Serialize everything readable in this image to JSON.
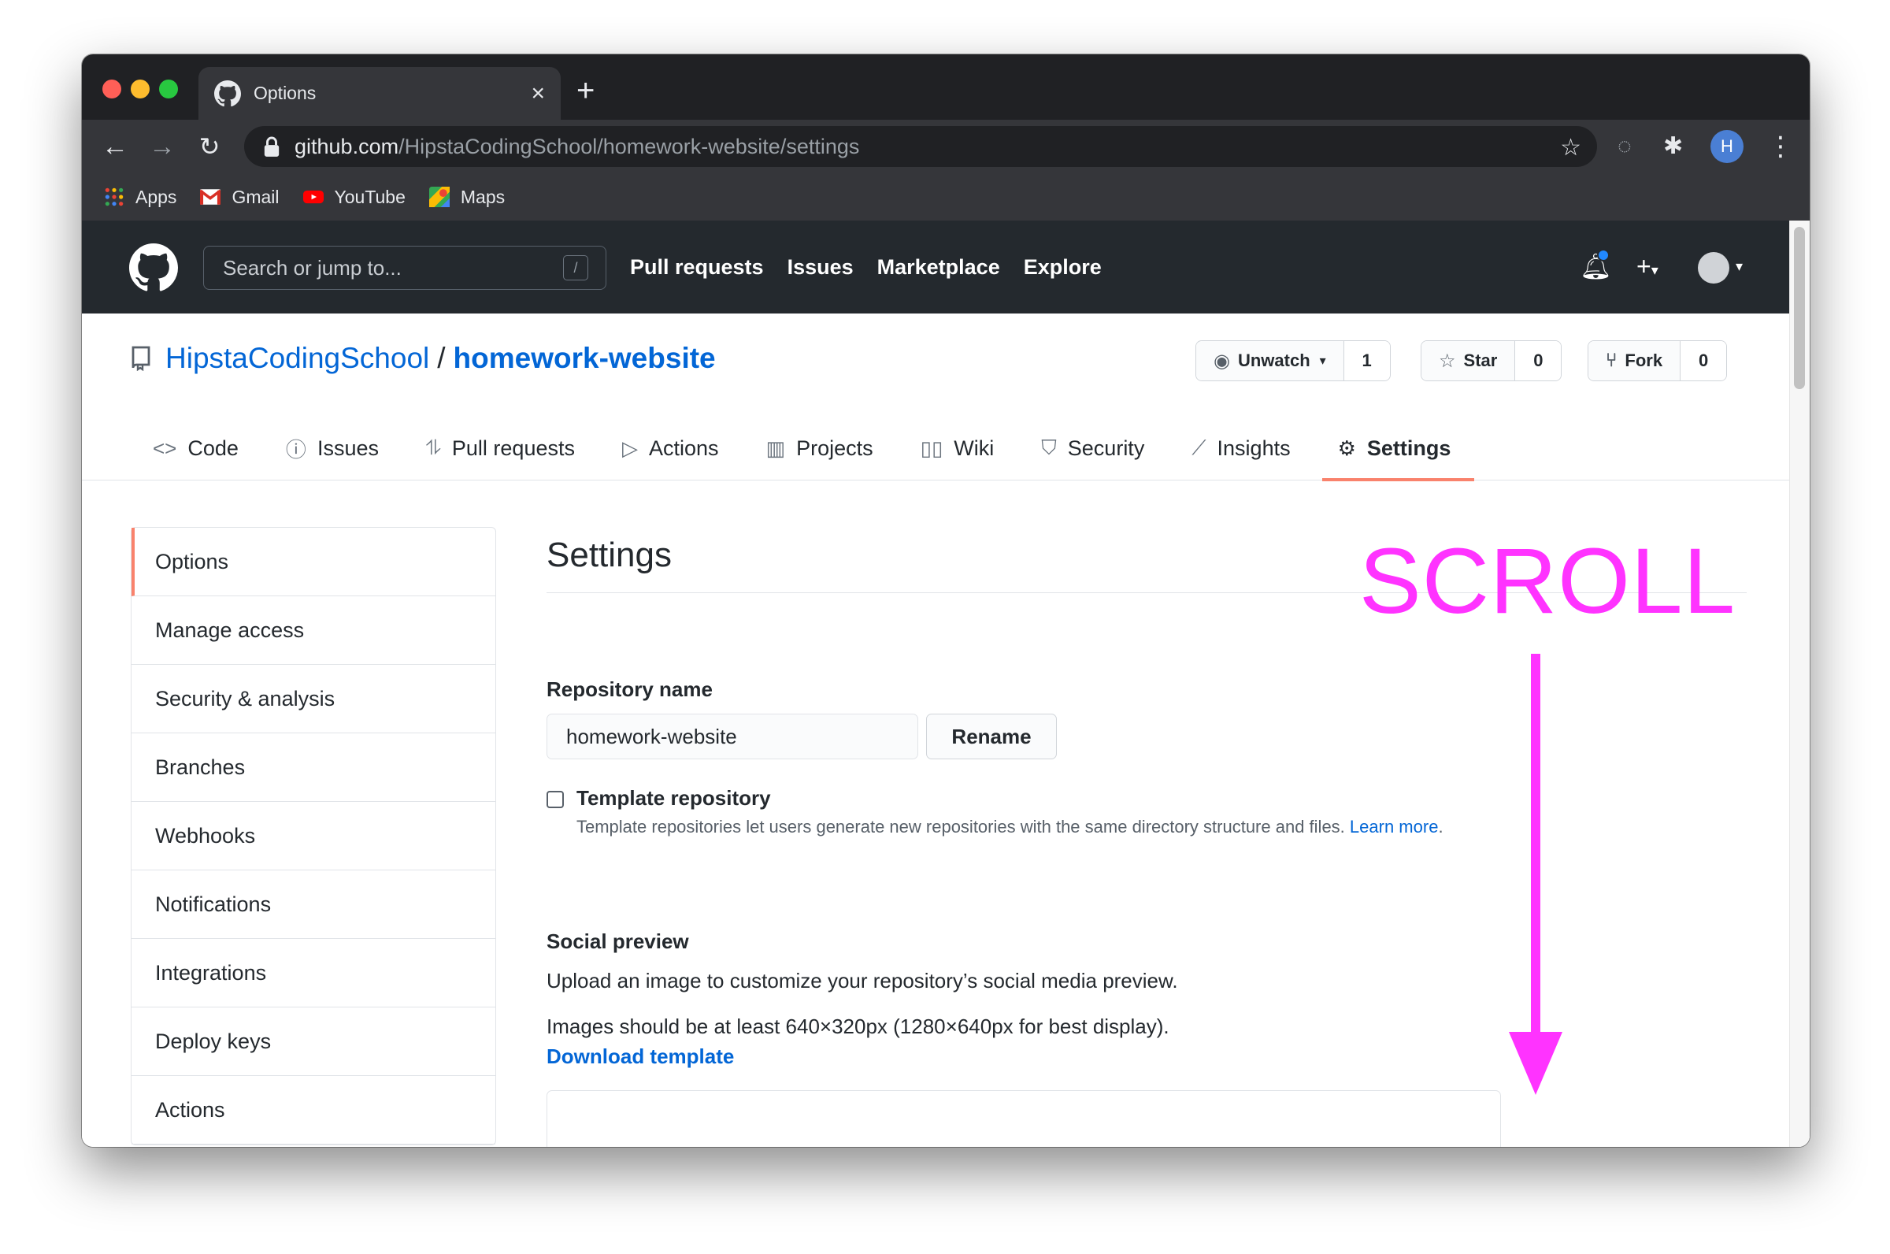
{
  "browser": {
    "tab_title": "Options",
    "close_glyph": "×",
    "new_tab_glyph": "+",
    "url_host": "github.com",
    "url_path": "/HipstaCodingSchool/homework-website/settings",
    "profile_letter": "H",
    "bookmarks": [
      {
        "label": "Apps",
        "icon": "apps-grid-icon"
      },
      {
        "label": "Gmail",
        "icon": "gmail-icon"
      },
      {
        "label": "YouTube",
        "icon": "youtube-icon"
      },
      {
        "label": "Maps",
        "icon": "maps-icon"
      }
    ]
  },
  "github": {
    "search_placeholder": "Search or jump to...",
    "search_key": "/",
    "nav": [
      "Pull requests",
      "Issues",
      "Marketplace",
      "Explore"
    ]
  },
  "repo": {
    "owner": "HipstaCodingSchool",
    "separator": "/",
    "name": "homework-website",
    "watch": {
      "label": "Unwatch",
      "count": "1"
    },
    "star": {
      "label": "Star",
      "count": "0"
    },
    "fork": {
      "label": "Fork",
      "count": "0"
    },
    "tabs": [
      {
        "label": "Code",
        "icon": "code-icon"
      },
      {
        "label": "Issues",
        "icon": "issue-opened-icon"
      },
      {
        "label": "Pull requests",
        "icon": "pull-request-icon"
      },
      {
        "label": "Actions",
        "icon": "play-icon"
      },
      {
        "label": "Projects",
        "icon": "project-icon"
      },
      {
        "label": "Wiki",
        "icon": "book-icon"
      },
      {
        "label": "Security",
        "icon": "shield-icon"
      },
      {
        "label": "Insights",
        "icon": "graph-icon"
      },
      {
        "label": "Settings",
        "icon": "gear-icon",
        "active": true
      }
    ]
  },
  "sidebar": {
    "items": [
      {
        "label": "Options",
        "active": true
      },
      {
        "label": "Manage access"
      },
      {
        "label": "Security & analysis"
      },
      {
        "label": "Branches"
      },
      {
        "label": "Webhooks"
      },
      {
        "label": "Notifications"
      },
      {
        "label": "Integrations"
      },
      {
        "label": "Deploy keys"
      },
      {
        "label": "Actions"
      }
    ]
  },
  "settings": {
    "title": "Settings",
    "repo_name_label": "Repository name",
    "repo_name_value": "homework-website",
    "rename_label": "Rename",
    "template_label": "Template repository",
    "template_note": "Template repositories let users generate new repositories with the same directory structure and files.",
    "learn_more": "Learn more",
    "template_checked": false,
    "social_preview_label": "Social preview",
    "social_preview_desc": "Upload an image to customize your repository’s social media preview.",
    "image_size_note": "Images should be at least 640×320px (1280×640px for best display).",
    "download_template": "Download template"
  },
  "annotation": {
    "text": "SCROLL",
    "color": "#ff33ff"
  },
  "colors": {
    "accent_tab": "#f9826c",
    "link": "#0366d6",
    "gh_header": "#24292e"
  }
}
